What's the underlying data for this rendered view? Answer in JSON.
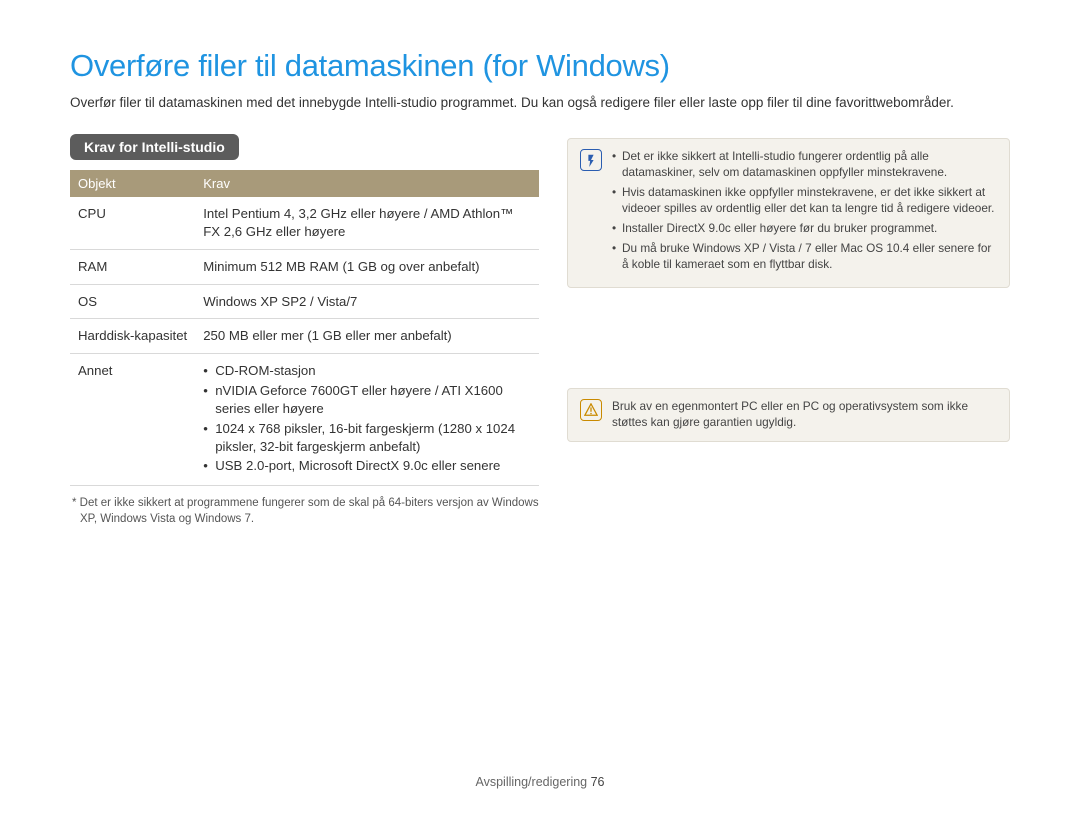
{
  "title": "Overføre filer til datamaskinen (for Windows)",
  "intro": "Overfør filer til datamaskinen med det innebygde Intelli-studio programmet. Du kan også redigere filer eller laste opp filer til dine favorittwebområder.",
  "requirements": {
    "badge": "Krav for Intelli-studio",
    "headers": {
      "col1": "Objekt",
      "col2": "Krav"
    },
    "rows": {
      "cpu": {
        "label": "CPU",
        "value": "Intel Pentium 4, 3,2 GHz eller høyere / AMD Athlon™ FX 2,6 GHz eller høyere"
      },
      "ram": {
        "label": "RAM",
        "value": "Minimum 512 MB RAM (1 GB og over anbefalt)"
      },
      "os": {
        "label": "OS",
        "value": "Windows XP SP2 / Vista/7"
      },
      "hdd": {
        "label": "Harddisk-kapasitet",
        "value": "250 MB eller mer (1 GB eller mer anbefalt)"
      },
      "other": {
        "label": "Annet",
        "items": [
          "CD-ROM-stasjon",
          "nVIDIA Geforce 7600GT eller høyere / ATI X1600 series eller høyere",
          "1024 x 768 piksler, 16-bit fargeskjerm (1280 x 1024 piksler, 32-bit fargeskjerm anbefalt)",
          "USB 2.0-port, Microsoft DirectX 9.0c eller senere"
        ]
      }
    },
    "footnote": "* Det er ikke sikkert at programmene fungerer som de skal på 64-biters versjon av Windows XP, Windows Vista og Windows 7."
  },
  "notes": {
    "info_items": [
      "Det er ikke sikkert at Intelli-studio fungerer ordentlig på alle datamaskiner, selv om datamaskinen oppfyller minstekravene.",
      "Hvis datamaskinen ikke oppfyller minstekravene, er det ikke sikkert at videoer spilles av ordentlig eller det kan ta lengre tid å redigere videoer.",
      "Installer DirectX 9.0c eller høyere før du bruker programmet.",
      "Du må bruke Windows XP / Vista / 7 eller Mac OS 10.4 eller senere for å koble til kameraet som en flyttbar disk."
    ],
    "caution": "Bruk av en egenmontert PC eller en PC og operativsystem som ikke støttes kan gjøre garantien ugyldig."
  },
  "footer": {
    "section": "Avspilling/redigering",
    "page": "76"
  }
}
